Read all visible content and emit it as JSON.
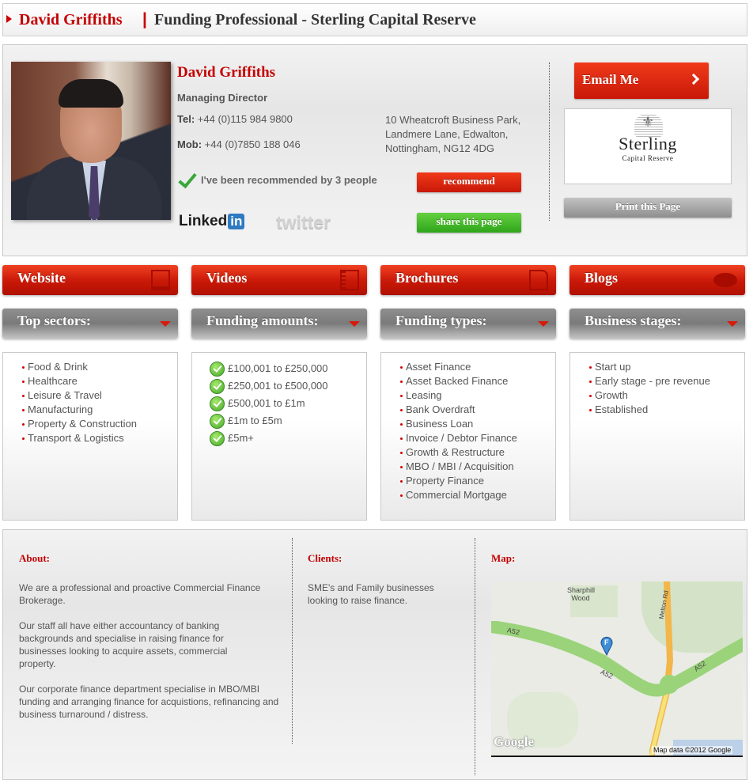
{
  "header": {
    "name": "David Griffiths",
    "separator": "|",
    "title": "Funding Professional - Sterling Capital Reserve"
  },
  "profile": {
    "name": "David Griffiths",
    "role": "Managing Director",
    "tel_label": "Tel:",
    "tel": "+44 (0)115 984 9800",
    "mob_label": "Mob:",
    "mob": "+44 (0)7850 188 046",
    "address": [
      "10 Wheatcroft Business Park,",
      "Landmere Lane, Edwalton,",
      "Nottingham, NG12 4DG"
    ],
    "recommended_text": "I've been recommended by 3 people",
    "recommend_label": "recommend",
    "share_label": "share this page",
    "linkedin_text": "Linked",
    "linkedin_in": "in",
    "twitter_text": "twitter",
    "email_label": "Email Me",
    "logo_line1": "Sterling",
    "logo_line2": "Capital Reserve",
    "print_label": "Print this Page"
  },
  "tabs": [
    {
      "label": "Website",
      "icon": "monitor-icon"
    },
    {
      "label": "Videos",
      "icon": "film-icon"
    },
    {
      "label": "Brochures",
      "icon": "document-icon"
    },
    {
      "label": "Blogs",
      "icon": "speech-bubble-icon"
    }
  ],
  "filters": [
    {
      "label": "Top sectors:"
    },
    {
      "label": "Funding amounts:"
    },
    {
      "label": "Funding types:"
    },
    {
      "label": "Business stages:"
    }
  ],
  "sectors": [
    "Food & Drink",
    "Healthcare",
    "Leisure & Travel",
    "Manufacturing",
    "Property & Construction",
    "Transport & Logistics"
  ],
  "amounts": [
    "£100,001 to £250,000",
    "£250,001 to £500,000",
    "£500,001 to £1m",
    "£1m to £5m",
    "£5m+"
  ],
  "types": [
    "Asset Finance",
    "Asset Backed Finance",
    "Leasing",
    "Bank Overdraft",
    "Business Loan",
    "Invoice / Debtor Finance",
    "Growth & Restructure",
    "MBO / MBI / Acquisition",
    "Property Finance",
    "Commercial Mortgage"
  ],
  "stages": [
    "Start up",
    "Early stage - pre revenue",
    "Growth",
    "Established"
  ],
  "about": {
    "heading": "About:",
    "paragraphs": [
      "We are a professional and proactive Commercial Finance Brokerage.",
      "Our staff all have either accountancy of banking backgrounds and specialise in raising finance for businesses looking to acquire assets, commercial property.",
      "Our corporate finance department specialise in MBO/MBI funding and arranging finance for acquistions, refinancing and business turnaround / distress."
    ]
  },
  "clients": {
    "heading": "Clients:",
    "text": "SME's and Family businesses looking to raise finance."
  },
  "map": {
    "heading": "Map:",
    "labels": {
      "wood": "Sharphill Wood",
      "road1": "A52",
      "road2": "A52",
      "road3": "A52",
      "mellon": "Melton Rd"
    },
    "pin_letter": "F",
    "google": "Google",
    "attribution": "Map data ©2012 Google"
  },
  "colors": {
    "accent": "#c40000",
    "green": "#39a63a"
  }
}
